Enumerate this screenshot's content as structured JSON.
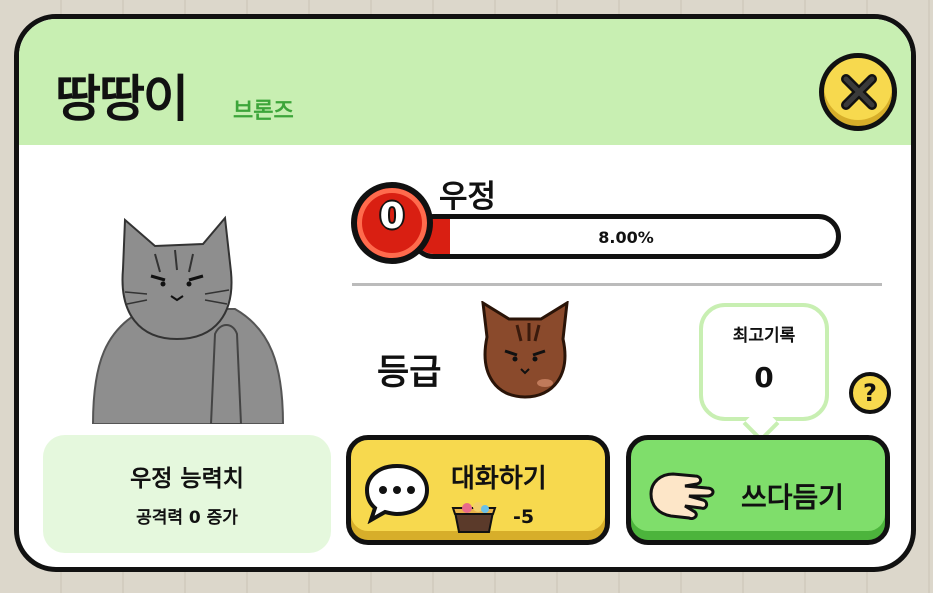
{
  "cat": {
    "name": "땅땅이",
    "rank": "브론즈"
  },
  "friendship": {
    "label": "우정",
    "level": "0",
    "percent_text": "8.00%",
    "progress": 0.08
  },
  "grade": {
    "label": "등급"
  },
  "record": {
    "title": "최고기록",
    "value": "0"
  },
  "stat": {
    "title": "우정 능력치",
    "desc": "공격력 0 증가"
  },
  "buttons": {
    "talk_label": "대화하기",
    "talk_cost": "-5",
    "pet_label": "쓰다듬기",
    "help": "?"
  },
  "colors": {
    "header": "#c8efb2",
    "accent_red": "#d91f12",
    "yellow": "#f7d94e",
    "green": "#7fde6b"
  },
  "icons": [
    "close-icon",
    "chat-bubble-icon",
    "food-box-icon",
    "hand-icon",
    "grade-cat-icon",
    "help-icon"
  ]
}
